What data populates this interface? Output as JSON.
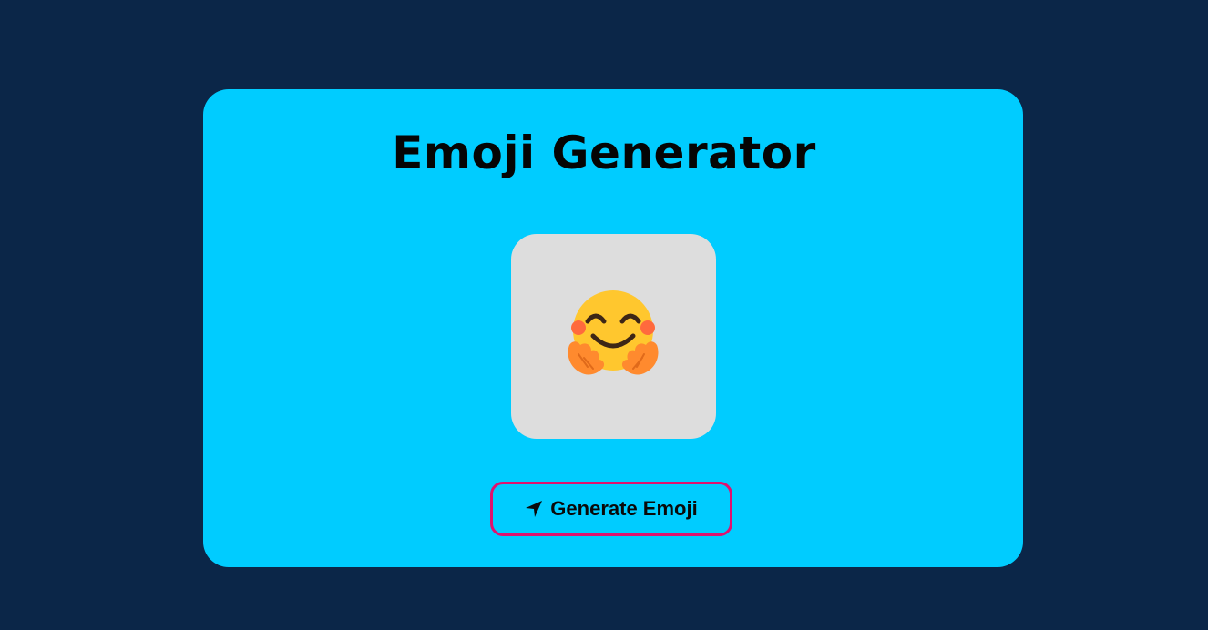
{
  "app": {
    "title": "Emoji Generator"
  },
  "emoji": {
    "display": "🤗",
    "icon_name": "hugging-face-emoji"
  },
  "button": {
    "label": "Generate Emoji",
    "icon_name": "location-arrow-icon",
    "border_color": "#e0126e"
  },
  "colors": {
    "page_background": "#0b2648",
    "card_background": "#00ccff",
    "emoji_box_background": "#dddddd"
  }
}
